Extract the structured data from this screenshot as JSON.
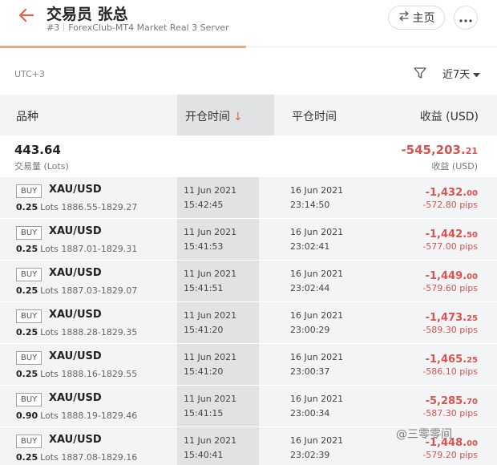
{
  "header": {
    "title": "交易员 张总",
    "account_no": "#3",
    "server": "ForexClub-MT4 Market Real 3 Server",
    "home_label": "主页"
  },
  "filter": {
    "timezone": "UTC+3",
    "range_label": "近7天"
  },
  "columns": {
    "symbol": "品种",
    "open_time": "开仓时间",
    "sort_arrow": "↓",
    "close_time": "平仓时间",
    "profit": "收益 (USD)"
  },
  "summary": {
    "lots": "443.64",
    "lots_label": "交易量 (Lots)",
    "profit_main": "-545,203.",
    "profit_cents": "21",
    "profit_label": "收益 (USD)"
  },
  "trades": [
    {
      "type": "BUY",
      "symbol": "XAU/USD",
      "lots": "0.25",
      "lots_unit": "Lots",
      "price_range": "1886.55-1829.27",
      "open_date": "11 Jun 2021",
      "open_time": "15:42:45",
      "close_date": "16 Jun 2021",
      "close_time": "23:14:50",
      "pnl_main": "-1,432.",
      "pnl_cents": "00",
      "pips": "-572.80 pips"
    },
    {
      "type": "BUY",
      "symbol": "XAU/USD",
      "lots": "0.25",
      "lots_unit": "Lots",
      "price_range": "1887.01-1829.31",
      "open_date": "11 Jun 2021",
      "open_time": "15:41:53",
      "close_date": "16 Jun 2021",
      "close_time": "23:02:41",
      "pnl_main": "-1,442.",
      "pnl_cents": "50",
      "pips": "-577.00 pips"
    },
    {
      "type": "BUY",
      "symbol": "XAU/USD",
      "lots": "0.25",
      "lots_unit": "Lots",
      "price_range": "1887.03-1829.07",
      "open_date": "11 Jun 2021",
      "open_time": "15:41:51",
      "close_date": "16 Jun 2021",
      "close_time": "23:02:44",
      "pnl_main": "-1,449.",
      "pnl_cents": "00",
      "pips": "-579.60 pips"
    },
    {
      "type": "BUY",
      "symbol": "XAU/USD",
      "lots": "0.25",
      "lots_unit": "Lots",
      "price_range": "1888.28-1829.35",
      "open_date": "11 Jun 2021",
      "open_time": "15:41:20",
      "close_date": "16 Jun 2021",
      "close_time": "23:00:29",
      "pnl_main": "-1,473.",
      "pnl_cents": "25",
      "pips": "-589.30 pips"
    },
    {
      "type": "BUY",
      "symbol": "XAU/USD",
      "lots": "0.25",
      "lots_unit": "Lots",
      "price_range": "1888.16-1829.55",
      "open_date": "11 Jun 2021",
      "open_time": "15:41:20",
      "close_date": "16 Jun 2021",
      "close_time": "23:00:37",
      "pnl_main": "-1,465.",
      "pnl_cents": "25",
      "pips": "-586.10 pips"
    },
    {
      "type": "BUY",
      "symbol": "XAU/USD",
      "lots": "0.90",
      "lots_unit": "Lots",
      "price_range": "1888.19-1829.46",
      "open_date": "11 Jun 2021",
      "open_time": "15:41:15",
      "close_date": "16 Jun 2021",
      "close_time": "23:00:34",
      "pnl_main": "-5,285.",
      "pnl_cents": "70",
      "pips": "-587.30 pips"
    },
    {
      "type": "BUY",
      "symbol": "XAU/USD",
      "lots": "0.25",
      "lots_unit": "Lots",
      "price_range": "1887.08-1829.16",
      "open_date": "11 Jun 2021",
      "open_time": "15:40:41",
      "close_date": "16 Jun 2021",
      "close_time": "23:02:39",
      "pnl_main": "-1,448.",
      "pnl_cents": "00",
      "pips": "-579.20 pips"
    }
  ],
  "watermark": "@三零零间",
  "colors": {
    "accent": "#e8a882",
    "loss": "#d9534f",
    "back_arrow": "#e0644b"
  }
}
